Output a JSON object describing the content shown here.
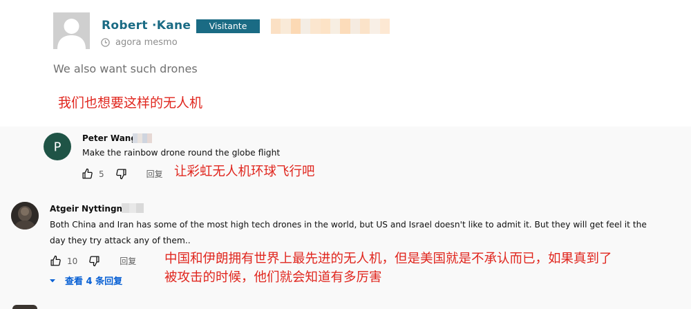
{
  "comment": {
    "author": "Robert ·Kane",
    "badge": "Visitante",
    "time": "agora mesmo",
    "text": "We also want such drones",
    "translation": "我们也想要这样的无人机"
  },
  "replies": [
    {
      "avatar_letter": "P",
      "author": "Peter Wang",
      "text": "Make the rainbow drone round the globe flight",
      "likes": "5",
      "reply_label": "回复",
      "translation": "让彩虹无人机环球飞行吧"
    },
    {
      "author": "Atgeir Nyttingnes",
      "text_line1": "Both China and Iran has some of the most high tech drones in the world, but US and Israel doesn't like to admit it. But they will get feel it the",
      "text_line2": "day they try attack any of them..",
      "likes": "10",
      "reply_label": "回复",
      "view_replies": "查看 4 条回复",
      "translation_line1": "中国和伊朗拥有世界上最先进的无人机，但是美国就是不承认而已，如果真到了",
      "translation_line2": "被攻击的时候，他们就会知道有多厉害"
    }
  ],
  "colors": {
    "accent": "#1a6b84",
    "annotation_red": "#e0261e",
    "link_blue": "#065fd4",
    "avatar_green": "#1f5446"
  },
  "icons": [
    "clock-icon",
    "thumb-up-icon",
    "thumb-down-icon",
    "chevron-down-icon"
  ]
}
